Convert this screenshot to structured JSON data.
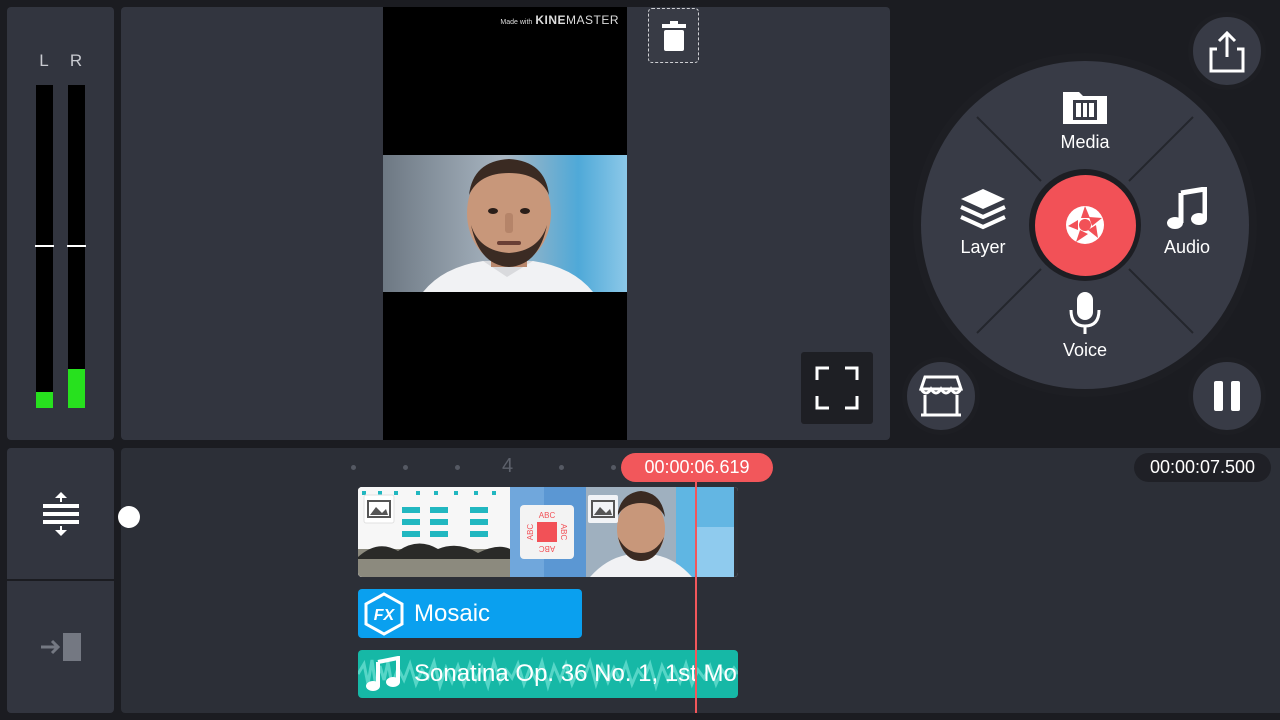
{
  "vu_meter": {
    "left_label": "L",
    "right_label": "R",
    "left_level": 0.05,
    "right_level": 0.12
  },
  "preview": {
    "watermark_small": "Made with",
    "watermark_brand_bold": "KINE",
    "watermark_brand": "MASTER",
    "delete_icon": "trash-icon",
    "fullscreen_icon": "fullscreen-icon"
  },
  "wheel": {
    "media_label": "Media",
    "layer_label": "Layer",
    "audio_label": "Audio",
    "voice_label": "Voice",
    "capture_icon": "camera-shutter-icon"
  },
  "buttons": {
    "share_icon": "share-icon",
    "store_icon": "store-icon",
    "pause_icon": "pause-icon"
  },
  "timeline": {
    "tick_label": "4",
    "playhead_time": "00:00:06.619",
    "total_time": "00:00:07.500",
    "fx_label": "Mosaic",
    "fx_badge": "FX",
    "audio_label": "Sonatina Op. 36 No. 1, 1st Mo",
    "transition_text": "ABC"
  },
  "colors": {
    "accent": "#f25157",
    "fx_clip": "#0aa0ef",
    "audio_clip": "#16b8a6",
    "meter_green": "#27e11e"
  }
}
